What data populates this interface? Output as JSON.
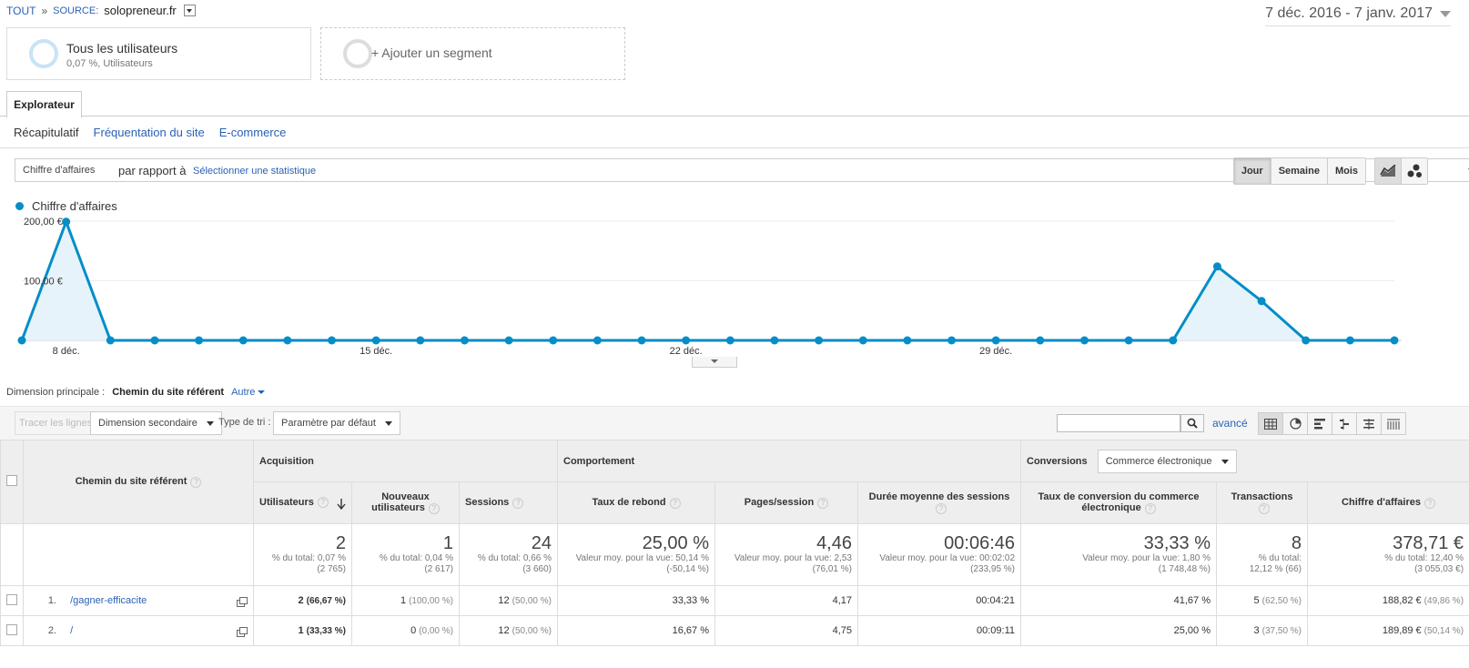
{
  "breadcrumb": {
    "all": "TOUT",
    "sep": "»",
    "source_label": "SOURCE:",
    "source_value": "solopreneur.fr"
  },
  "date_range": "7 déc. 2016 - 7 janv. 2017",
  "segments": {
    "all": {
      "title": "Tous les utilisateurs",
      "subtitle": "0,07 %, Utilisateurs"
    },
    "add": {
      "label": "+ Ajouter un segment"
    }
  },
  "tabs": {
    "explorer": "Explorateur"
  },
  "subtabs": [
    "Récapitulatif",
    "Fréquentation du site",
    "E-commerce"
  ],
  "metric": {
    "selected": "Chiffre d'affaires",
    "compare_label": "par rapport à",
    "select_stat": "Sélectionner une statistique"
  },
  "period_buttons": [
    "Jour",
    "Semaine",
    "Mois"
  ],
  "period_active": "Jour",
  "chart_data": {
    "type": "line",
    "series": [
      {
        "name": "Chiffre d'affaires",
        "color": "#058dc7",
        "values": [
          0,
          199,
          0,
          0,
          0,
          0,
          0,
          0,
          0,
          0,
          0,
          0,
          0,
          0,
          0,
          0,
          0,
          0,
          0,
          0,
          0,
          0,
          0,
          0,
          0,
          0,
          0,
          124,
          66,
          0,
          0,
          0
        ]
      }
    ],
    "x": [
      "7 déc.",
      "8 déc.",
      "9 déc.",
      "10 déc.",
      "11 déc.",
      "12 déc.",
      "13 déc.",
      "14 déc.",
      "15 déc.",
      "16 déc.",
      "17 déc.",
      "18 déc.",
      "19 déc.",
      "20 déc.",
      "21 déc.",
      "22 déc.",
      "23 déc.",
      "24 déc.",
      "25 déc.",
      "26 déc.",
      "27 déc.",
      "28 déc.",
      "29 déc.",
      "30 déc.",
      "31 déc.",
      "1 janv.",
      "2 janv.",
      "3 janv.",
      "4 janv.",
      "5 janv.",
      "6 janv.",
      "7 janv."
    ],
    "ylim": [
      0,
      200
    ],
    "y_tick_labels": [
      "100,00 €",
      "200,00 €"
    ],
    "y_ticks": [
      100,
      200
    ],
    "x_tick_labels": [
      "8 déc.",
      "15 déc.",
      "22 déc.",
      "29 déc."
    ],
    "x_tick_indices": [
      1,
      8,
      15,
      22
    ],
    "grid": true
  },
  "dimension": {
    "label": "Dimension principale :",
    "active": "Chemin du site référent",
    "other": "Autre"
  },
  "toolbar": {
    "trace_lines": "Tracer les lignes",
    "secondary_dimension": "Dimension secondaire",
    "sort_label": "Type de tri :",
    "sort_value": "Paramètre par défaut",
    "search_value": "",
    "advanced": "avancé"
  },
  "table": {
    "groups": {
      "acquisition": "Acquisition",
      "behavior": "Comportement",
      "conversions": "Conversions",
      "conversion_select": "Commerce électronique"
    },
    "columns": {
      "path": "Chemin du site référent",
      "users": "Utilisateurs",
      "new_users": "Nouveaux utilisateurs",
      "sessions": "Sessions",
      "bounce": "Taux de rebond",
      "pages": "Pages/session",
      "duration": "Durée moyenne des sessions",
      "conv_rate": "Taux de conversion du commerce électronique",
      "transactions": "Transactions",
      "revenue": "Chiffre d'affaires"
    },
    "totals": {
      "users": {
        "main": "2",
        "sub1": "% du total: 0,07 %",
        "sub2": "(2 765)"
      },
      "new_users": {
        "main": "1",
        "sub1": "% du total: 0,04 %",
        "sub2": "(2 617)"
      },
      "sessions": {
        "main": "24",
        "sub1": "% du total: 0,66 %",
        "sub2": "(3 660)"
      },
      "bounce": {
        "main": "25,00 %",
        "sub1": "Valeur moy. pour la vue: 50,14 %",
        "sub2": "(-50,14 %)"
      },
      "pages": {
        "main": "4,46",
        "sub1": "Valeur moy. pour la vue: 2,53",
        "sub2": "(76,01 %)"
      },
      "duration": {
        "main": "00:06:46",
        "sub1": "Valeur moy. pour la vue: 00:02:02",
        "sub2": "(233,95 %)"
      },
      "conv_rate": {
        "main": "33,33 %",
        "sub1": "Valeur moy. pour la vue: 1,80 %",
        "sub2": "(1 748,48 %)"
      },
      "transactions": {
        "main": "8",
        "sub1": "% du total:",
        "sub2": "12,12 % (66)"
      },
      "revenue": {
        "main": "378,71 €",
        "sub1": "% du total: 12,40 %",
        "sub2": "(3 055,03 €)"
      }
    },
    "rows": [
      {
        "index": "1.",
        "path": "/gagner-efficacite",
        "users": "2",
        "users_pct": "(66,67 %)",
        "new_users": "1",
        "new_users_pct": "(100,00 %)",
        "sessions": "12",
        "sessions_pct": "(50,00 %)",
        "bounce": "33,33 %",
        "pages": "4,17",
        "duration": "00:04:21",
        "conv_rate": "41,67 %",
        "transactions": "5",
        "transactions_pct": "(62,50 %)",
        "revenue": "188,82 €",
        "revenue_pct": "(49,86 %)"
      },
      {
        "index": "2.",
        "path": "/",
        "users": "1",
        "users_pct": "(33,33 %)",
        "new_users": "0",
        "new_users_pct": "(0,00 %)",
        "sessions": "12",
        "sessions_pct": "(50,00 %)",
        "bounce": "16,67 %",
        "pages": "4,75",
        "duration": "00:09:11",
        "conv_rate": "25,00 %",
        "transactions": "3",
        "transactions_pct": "(37,50 %)",
        "revenue": "189,89 €",
        "revenue_pct": "(50,14 %)"
      }
    ]
  }
}
